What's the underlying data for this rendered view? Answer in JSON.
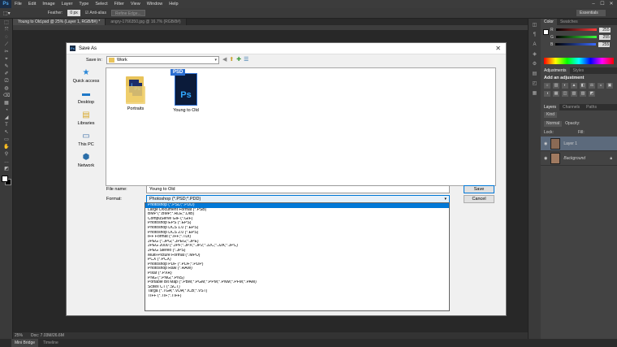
{
  "app": {
    "logo": "Ps",
    "menu": [
      "File",
      "Edit",
      "Image",
      "Layer",
      "Type",
      "Select",
      "Filter",
      "View",
      "Window",
      "Help"
    ],
    "window_controls": [
      "–",
      "☐",
      "✕"
    ]
  },
  "options_bar": {
    "feather_label": "Feather:",
    "feather_value": "0 px",
    "anti_alias": "Anti-alias",
    "refine_edge": "Refine Edge...",
    "workspace": "Essentials"
  },
  "doc_tabs": [
    {
      "label": "Young to Old.psd @ 25% (Layer 1, RGB/8#) *",
      "active": true
    },
    {
      "label": "angry-1766350.jpg @ 16.7% (RGB/8#)",
      "active": false
    }
  ],
  "status_bar": {
    "zoom": "25%",
    "doc": "Doc: 7.03M/26.6M"
  },
  "bottom_tabs": [
    {
      "label": "Mini Bridge",
      "active": true
    },
    {
      "label": "Timeline",
      "active": false
    }
  ],
  "right_panel": {
    "color_tabs": [
      "Color",
      "Swatches"
    ],
    "sliders": [
      {
        "label": "R",
        "value": "255",
        "color": "#ff3b3b"
      },
      {
        "label": "G",
        "value": "255",
        "color": "#3bff3b"
      },
      {
        "label": "B",
        "value": "255",
        "color": "#3b6bff"
      }
    ],
    "adjust_tabs": [
      "Adjustments",
      "Styles"
    ],
    "adjust_title": "Add an adjustment",
    "adjust_icons": [
      "☼",
      "▥",
      "◐",
      "▲",
      "◧",
      "⚖",
      "◒",
      "▣",
      "◑",
      "▦",
      "◫",
      "▧",
      "▨",
      "◩"
    ],
    "layers_tabs": [
      "Layers",
      "Channels",
      "Paths"
    ],
    "layer_kind": "Kind",
    "blend_mode": "Normal",
    "opacity": "Opacity:",
    "lock": "Lock:",
    "fill": "Fill:",
    "layers": [
      {
        "name": "Layer 1",
        "active": true
      },
      {
        "name": "Background",
        "active": false
      }
    ]
  },
  "dialog": {
    "title": "Save As",
    "close": "✕",
    "save_in_label": "Save in:",
    "save_in_value": "Work",
    "nav_icons": [
      "◀",
      "⬆",
      "✚",
      "☰"
    ],
    "places": [
      {
        "label": "Quick access",
        "icon": "★",
        "color": "#2b88d8"
      },
      {
        "label": "Desktop",
        "icon": "▬",
        "color": "#1e78c8"
      },
      {
        "label": "Libraries",
        "icon": "▤",
        "color": "#d8a82b"
      },
      {
        "label": "This PC",
        "icon": "▭",
        "color": "#3c6fa8"
      },
      {
        "label": "Network",
        "icon": "⬢",
        "color": "#2b6ea8"
      }
    ],
    "files": [
      {
        "name": "Portraits",
        "type": "folder"
      },
      {
        "name": "Young to Old",
        "type": "psd",
        "tag": "PSD",
        "glyph": "Ps"
      }
    ],
    "file_name_label": "File name:",
    "file_name_value": "Young to Old",
    "format_label": "Format:",
    "format_value": "Photoshop (*.PSD;*.PDD)",
    "save_label": "Save",
    "cancel_label": "Cancel",
    "format_options": [
      "Photoshop (*.PSD;*.PDD)",
      "Large Document Format (*.PSB)",
      "BMP (*.BMP;*.RLE;*.DIB)",
      "CompuServe GIF (*.GIF)",
      "Photoshop EPS (*.EPS)",
      "Photoshop DCS 1.0 (*.EPS)",
      "Photoshop DCS 2.0 (*.EPS)",
      "IFF Format (*.IFF;*.TDI)",
      "JPEG (*.JPG;*.JPEG;*.JPE)",
      "JPEG 2000 (*.JPF;*.JPX;*.JP2;*.J2C;*.J2K;*.JPC)",
      "JPEG Stereo (*.JPS)",
      "Multi-Picture Format (*.MPO)",
      "PCX (*.PCX)",
      "Photoshop PDF (*.PDF;*.PDP)",
      "Photoshop Raw (*.RAW)",
      "Pixar (*.PXR)",
      "PNG (*.PNG;*.PNS)",
      "Portable Bit Map (*.PBM;*.PGM;*.PPM;*.PNM;*.PFM;*.PAM)",
      "Scitex CT (*.SCT)",
      "Targa (*.TGA;*.VDA;*.ICB;*.VST)",
      "TIFF (*.TIF;*.TIFF)"
    ],
    "selected_format_index": 0
  },
  "toolbar_icons": [
    "⬚",
    "⤧",
    "◌",
    "⟋",
    "✂",
    "⌖",
    "✎",
    "✐",
    "⎚",
    "◍",
    "⌫",
    "▦",
    "◔",
    "◢",
    "T",
    "↖",
    "▭",
    "✋",
    "⚲",
    "…",
    "◩"
  ],
  "panel_side_icons": [
    "◫",
    "¶",
    "A",
    "◈",
    "⚙",
    "▤",
    "◰",
    "▦"
  ]
}
